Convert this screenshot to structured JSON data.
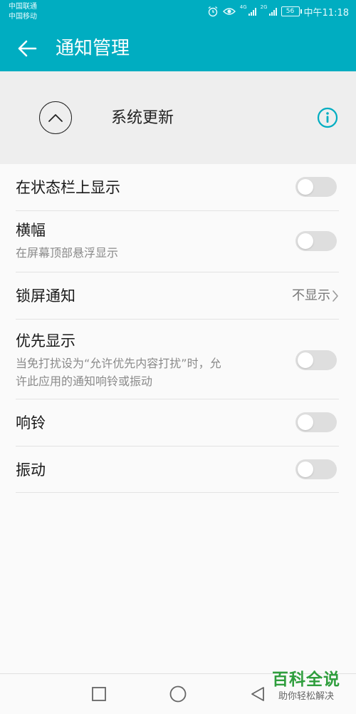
{
  "status_bar": {
    "carrier_1": "中国联通",
    "carrier_2": "中国移动",
    "net_1": "4G",
    "net_2": "2G",
    "battery": "56",
    "time": "中午11:18",
    "icons": [
      "alarm-icon",
      "eye-icon",
      "signal-icon",
      "signal-icon",
      "battery-icon"
    ]
  },
  "header": {
    "title": "通知管理",
    "back_icon": "arrow-left-icon"
  },
  "app": {
    "name": "系统更新",
    "collapse_icon": "chevron-up-icon",
    "info_icon": "info-icon"
  },
  "settings": [
    {
      "title": "在状态栏上显示",
      "toggle_on": false
    },
    {
      "title": "横幅",
      "subtitle": "在屏幕顶部悬浮显示",
      "toggle_on": false
    },
    {
      "title": "锁屏通知",
      "value": "不显示"
    },
    {
      "title": "优先显示",
      "subtitle_line1": "当免打扰设为“允许优先内容打扰”时，允",
      "subtitle_line2": "许此应用的通知响铃或振动",
      "toggle_on": false
    },
    {
      "title": "响铃",
      "toggle_on": false
    },
    {
      "title": "振动",
      "toggle_on": false
    }
  ],
  "nav": {
    "icons": [
      "square-icon",
      "circle-icon",
      "triangle-back-icon"
    ]
  },
  "watermark": {
    "title": "百科全说",
    "subtitle": "助你轻松解决"
  },
  "colors": {
    "accent": "#00adc1",
    "toggle_off": "#dedede",
    "watermark_green": "#2f9e3d"
  }
}
